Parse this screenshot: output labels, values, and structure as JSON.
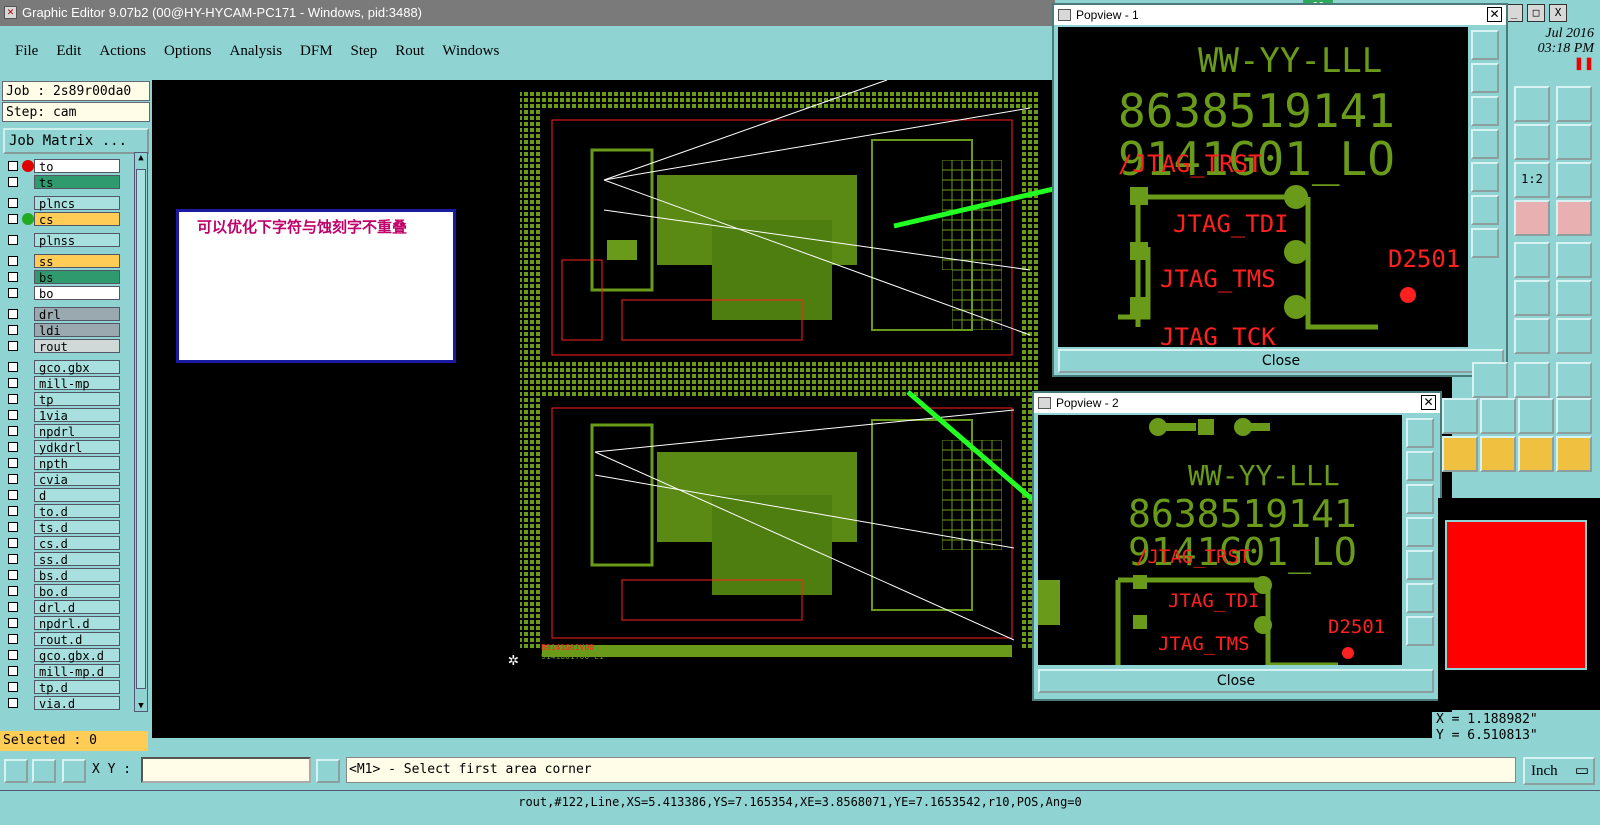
{
  "window": {
    "title": "Graphic Editor 9.07b2 (00@HY-HYCAM-PC171 - Windows, pid:3488)",
    "badge": "66",
    "controls": [
      "_",
      "□",
      "X"
    ]
  },
  "menu": [
    "File",
    "Edit",
    "Actions",
    "Options",
    "Analysis",
    "DFM",
    "Step",
    "Rout",
    "Windows"
  ],
  "job": {
    "job_label": "Job : 2s89r00da0",
    "step_label": "Step: cam",
    "matrix_button": "Job Matrix ..."
  },
  "layers": [
    {
      "name": "to",
      "color": "#ffffff"
    },
    {
      "name": "ts",
      "color": "#2e9a6e"
    },
    {
      "name": "plncs",
      "color": "#a8e0e0"
    },
    {
      "name": "cs",
      "color": "#ffcc55"
    },
    {
      "name": "plnss",
      "color": "#a8e0e0"
    },
    {
      "name": "ss",
      "color": "#ffcc55"
    },
    {
      "name": "bs",
      "color": "#2e9a6e"
    },
    {
      "name": "bo",
      "color": "#ffffff"
    },
    {
      "name": "drl",
      "color": "#9aa8b0"
    },
    {
      "name": "ldi",
      "color": "#9aa8b0"
    },
    {
      "name": "rout",
      "color": "#d0d8d8"
    },
    {
      "name": "gco.gbx",
      "color": "#a8e0e0"
    },
    {
      "name": "mill-mp",
      "color": "#a8e0e0"
    },
    {
      "name": "tp",
      "color": "#a8e0e0"
    },
    {
      "name": "1via",
      "color": "#a8e0e0"
    },
    {
      "name": "npdrl",
      "color": "#a8e0e0"
    },
    {
      "name": "ydkdrl",
      "color": "#a8e0e0"
    },
    {
      "name": "npth",
      "color": "#a8e0e0"
    },
    {
      "name": "cvia",
      "color": "#a8e0e0"
    },
    {
      "name": "d",
      "color": "#a8e0e0"
    },
    {
      "name": "to.d",
      "color": "#a8e0e0"
    },
    {
      "name": "ts.d",
      "color": "#a8e0e0"
    },
    {
      "name": "cs.d",
      "color": "#a8e0e0"
    },
    {
      "name": "ss.d",
      "color": "#a8e0e0"
    },
    {
      "name": "bs.d",
      "color": "#a8e0e0"
    },
    {
      "name": "bo.d",
      "color": "#a8e0e0"
    },
    {
      "name": "drl.d",
      "color": "#a8e0e0"
    },
    {
      "name": "npdrl.d",
      "color": "#a8e0e0"
    },
    {
      "name": "rout.d",
      "color": "#a8e0e0"
    },
    {
      "name": "gco.gbx.d",
      "color": "#a8e0e0"
    },
    {
      "name": "mill-mp.d",
      "color": "#a8e0e0"
    },
    {
      "name": "tp.d",
      "color": "#a8e0e0"
    },
    {
      "name": "via.d",
      "color": "#a8e0e0"
    }
  ],
  "selected": "Selected : 0",
  "note": "可以优化下字符与蚀刻字不重叠",
  "board": {
    "silk_text_1": "B9141G01V00",
    "silk_text_2": "9141G01Y00-L1"
  },
  "popview1": {
    "title": "Popview - 1",
    "close": "Close",
    "silk": [
      "WW-YY-LLL",
      "8638519141",
      "9141G01_LO"
    ],
    "labels": [
      "/JTAG_TRST",
      "JTAG_TDI",
      "JTAG_TMS",
      "JTAG_TCK",
      "D2501"
    ]
  },
  "popview2": {
    "title": "Popview - 2",
    "close": "Close",
    "silk": [
      "WW-YY-LLL",
      "8638519141",
      "9141G01_LO"
    ],
    "labels": [
      "/JTAG_TRST",
      "JTAG_TDI",
      "JTAG_TMS",
      "D2501"
    ]
  },
  "datetime": {
    "date": "Jul 2016",
    "time": "03:18 PM"
  },
  "coords": {
    "x": "X = 1.188982\"",
    "y": "Y = 6.510813\""
  },
  "input": {
    "xy_label": "X Y :",
    "prompt": "<M1> - Select first area corner",
    "unit": "Inch"
  },
  "status": "rout,#122,Line,XS=5.413386,YS=7.165354,XE=3.8568071,YE=7.1653542,r10,POS,Ang=0",
  "tool_icons": [
    "1:2"
  ],
  "colors": {
    "panel": "#8fd3d3",
    "pcb_green": "#6a9a1a",
    "pcb_red": "#ff2020",
    "arrow": "#22ff22"
  }
}
